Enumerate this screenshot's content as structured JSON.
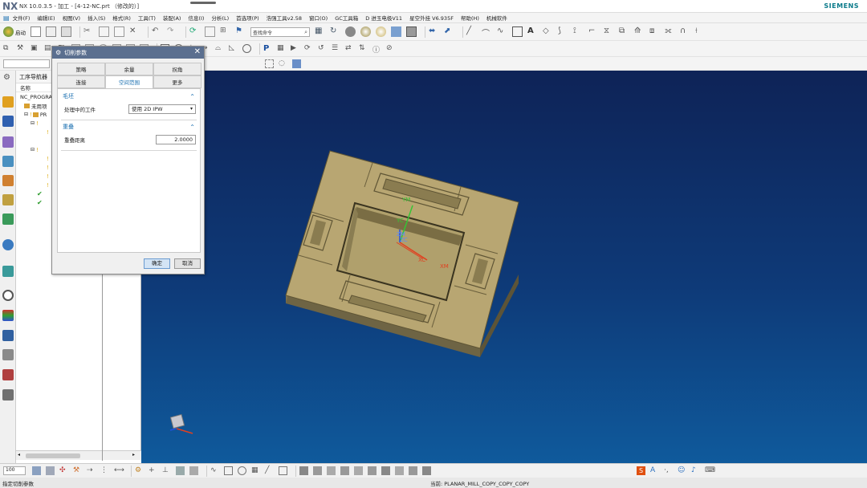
{
  "app": {
    "logo": "NX",
    "title": "NX 10.0.3.5 - 加工 - [4-12-NC.prt （修改的）]",
    "brand": "SIEMENS"
  },
  "menu": [
    "文件(F)",
    "编辑(E)",
    "视图(V)",
    "插入(S)",
    "格式(R)",
    "工具(T)",
    "装配(A)",
    "信息(I)",
    "分析(L)",
    "首选项(P)",
    "浩强工具v2.58",
    "窗口(O)",
    "GC工具箱",
    "D 进玉电极V11",
    "星空外挂 V6.935F",
    "帮助(H)",
    "机械软件"
  ],
  "toolbar": {
    "start_label": "启动",
    "command_finder": "查找命令"
  },
  "navigator": {
    "title": "工序导航器",
    "column_name": "名称",
    "rows": [
      {
        "label": "NC_PROGRAM"
      },
      {
        "label": "未用项"
      },
      {
        "label": "PR"
      }
    ]
  },
  "dialog": {
    "title": "切削参数",
    "tabs_row1": [
      "策略",
      "余量",
      "拐角"
    ],
    "tabs_row2": [
      "连接",
      "空间范围",
      "更多"
    ],
    "active_tab": "空间范围",
    "group1": {
      "title": "毛坯",
      "field_label": "处理中的工件",
      "field_value": "使用 2D IPW"
    },
    "group2": {
      "title": "重叠",
      "field_label": "重叠距离",
      "field_value": "2.0000"
    },
    "ok_label": "确定",
    "cancel_label": "取消"
  },
  "viewport": {
    "axis_labels": {
      "ym": "YM",
      "yc": "YC",
      "zm": "ZM",
      "zc": "ZC",
      "xc": "XC",
      "xm": "XM"
    },
    "part_color": "#b8a672"
  },
  "bottombar": {
    "zoom": "100"
  },
  "status": {
    "left": "指定切削参数",
    "right": "当前: PLANAR_MILL_COPY_COPY_COPY"
  },
  "colors": {
    "accent": "#1a6fb0",
    "dialog_title": "#5b6f8f",
    "viewport_top": "#0e2357",
    "viewport_bottom": "#0f5a9c"
  }
}
